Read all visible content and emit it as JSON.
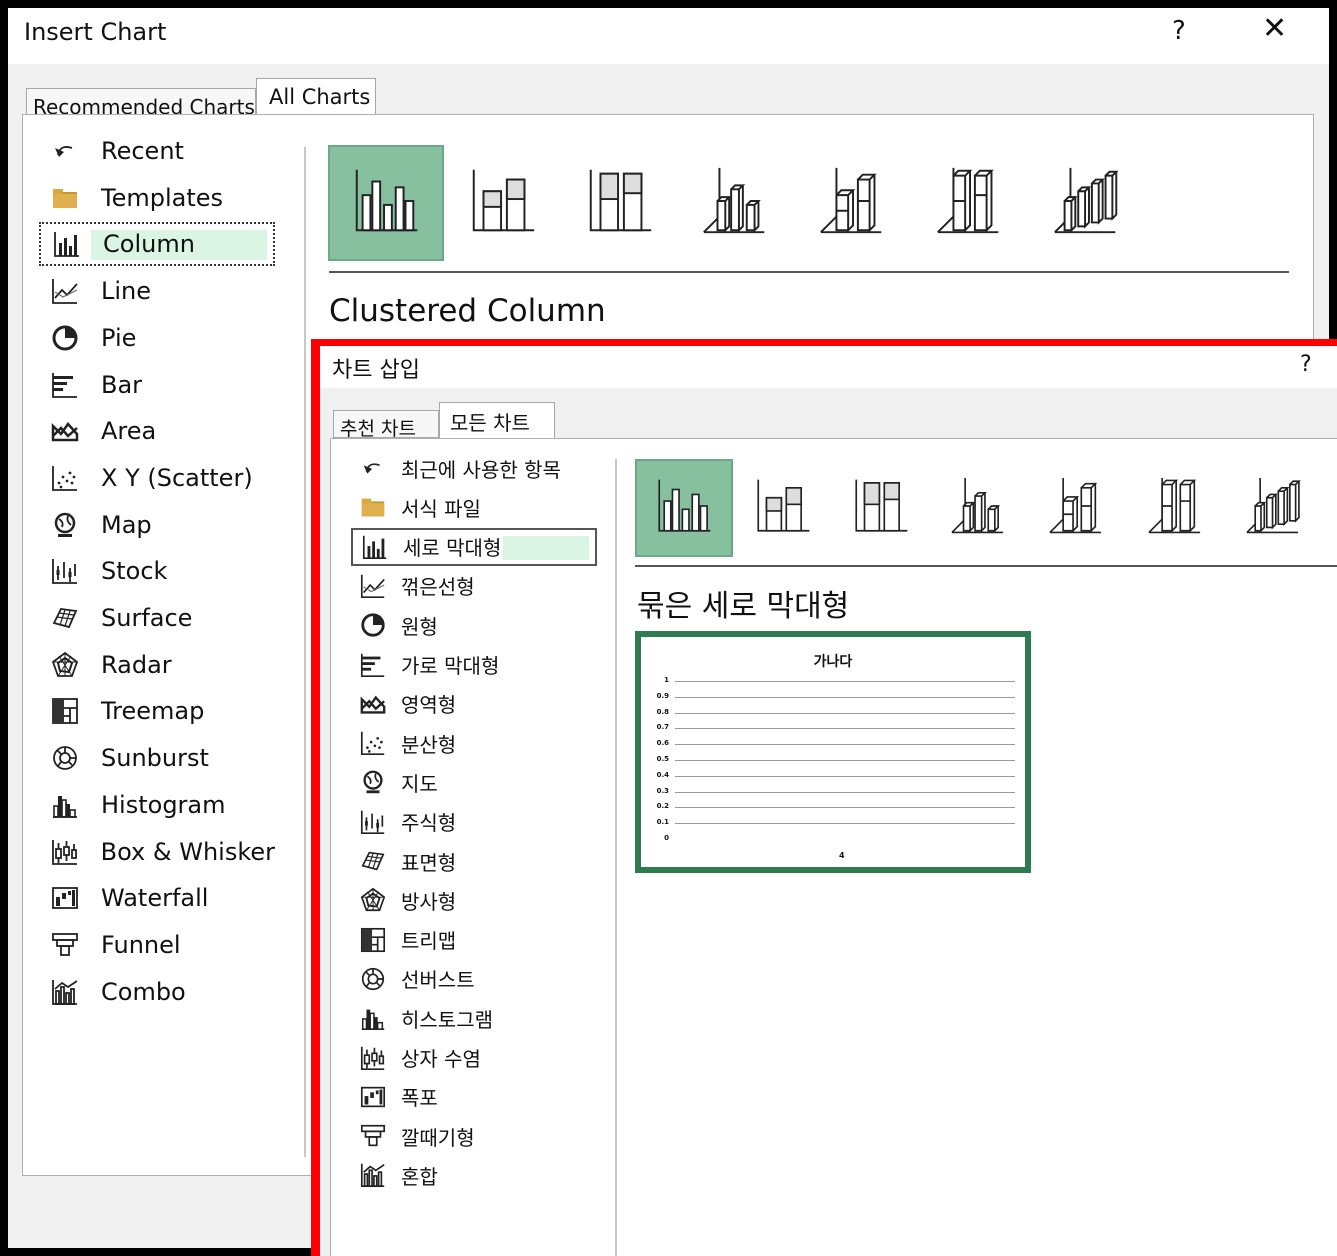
{
  "dialog_en": {
    "title": "Insert Chart",
    "help": "?",
    "close": "✕",
    "tabs": [
      "Recommended Charts",
      "All Charts"
    ],
    "selected_tab": "All Charts",
    "categories": [
      {
        "label": "Recent",
        "icon": "recent-icon"
      },
      {
        "label": "Templates",
        "icon": "templates-folder-icon"
      },
      {
        "label": "Column",
        "icon": "column-chart-icon",
        "selected": true
      },
      {
        "label": "Line",
        "icon": "line-chart-icon"
      },
      {
        "label": "Pie",
        "icon": "pie-chart-icon"
      },
      {
        "label": "Bar",
        "icon": "bar-chart-icon"
      },
      {
        "label": "Area",
        "icon": "area-chart-icon"
      },
      {
        "label": "X Y (Scatter)",
        "icon": "scatter-chart-icon"
      },
      {
        "label": "Map",
        "icon": "map-chart-icon"
      },
      {
        "label": "Stock",
        "icon": "stock-chart-icon"
      },
      {
        "label": "Surface",
        "icon": "surface-chart-icon"
      },
      {
        "label": "Radar",
        "icon": "radar-chart-icon"
      },
      {
        "label": "Treemap",
        "icon": "treemap-chart-icon"
      },
      {
        "label": "Sunburst",
        "icon": "sunburst-chart-icon"
      },
      {
        "label": "Histogram",
        "icon": "histogram-chart-icon"
      },
      {
        "label": "Box & Whisker",
        "icon": "box-whisker-chart-icon"
      },
      {
        "label": "Waterfall",
        "icon": "waterfall-chart-icon"
      },
      {
        "label": "Funnel",
        "icon": "funnel-chart-icon"
      },
      {
        "label": "Combo",
        "icon": "combo-chart-icon"
      }
    ],
    "subtypes": [
      "clustered-column-icon",
      "stacked-column-icon",
      "100-stacked-column-icon",
      "3d-clustered-column-icon",
      "3d-stacked-column-icon",
      "3d-100-stacked-column-icon",
      "3d-column-icon"
    ],
    "selected_subtype_title": "Clustered Column"
  },
  "dialog_ko": {
    "title": "차트 삽입",
    "help": "?",
    "tabs": [
      "추천 차트",
      "모든 차트"
    ],
    "selected_tab": "모든 차트",
    "categories": [
      {
        "label": "최근에 사용한 항목",
        "icon": "recent-icon"
      },
      {
        "label": "서식 파일",
        "icon": "templates-folder-icon"
      },
      {
        "label": "세로 막대형",
        "icon": "column-chart-icon",
        "selected": true
      },
      {
        "label": "꺾은선형",
        "icon": "line-chart-icon"
      },
      {
        "label": "원형",
        "icon": "pie-chart-icon"
      },
      {
        "label": "가로 막대형",
        "icon": "bar-chart-icon"
      },
      {
        "label": "영역형",
        "icon": "area-chart-icon"
      },
      {
        "label": "분산형",
        "icon": "scatter-chart-icon"
      },
      {
        "label": "지도",
        "icon": "map-chart-icon"
      },
      {
        "label": "주식형",
        "icon": "stock-chart-icon"
      },
      {
        "label": "표면형",
        "icon": "surface-chart-icon"
      },
      {
        "label": "방사형",
        "icon": "radar-chart-icon"
      },
      {
        "label": "트리맵",
        "icon": "treemap-chart-icon"
      },
      {
        "label": "선버스트",
        "icon": "sunburst-chart-icon"
      },
      {
        "label": "히스토그램",
        "icon": "histogram-chart-icon"
      },
      {
        "label": "상자 수염",
        "icon": "box-whisker-chart-icon"
      },
      {
        "label": "폭포",
        "icon": "waterfall-chart-icon"
      },
      {
        "label": "깔때기형",
        "icon": "funnel-chart-icon"
      },
      {
        "label": "혼합",
        "icon": "combo-chart-icon"
      }
    ],
    "subtypes": [
      "clustered-column-icon",
      "stacked-column-icon",
      "100-stacked-column-icon",
      "3d-clustered-column-icon",
      "3d-stacked-column-icon",
      "3d-100-stacked-column-icon",
      "3d-column-icon"
    ],
    "selected_subtype_title": "묶은 세로 막대형",
    "preview": {
      "title": "가나다",
      "y_ticks": [
        "1",
        "0.9",
        "0.8",
        "0.7",
        "0.6",
        "0.5",
        "0.4",
        "0.3",
        "0.2",
        "0.1",
        "0"
      ],
      "x_tick": "4"
    }
  },
  "colors": {
    "selected_thumb": "#86c09e",
    "preview_border": "#2f7a4f",
    "highlight": "#dbf5e5",
    "annotation_box": "#ff0000"
  }
}
